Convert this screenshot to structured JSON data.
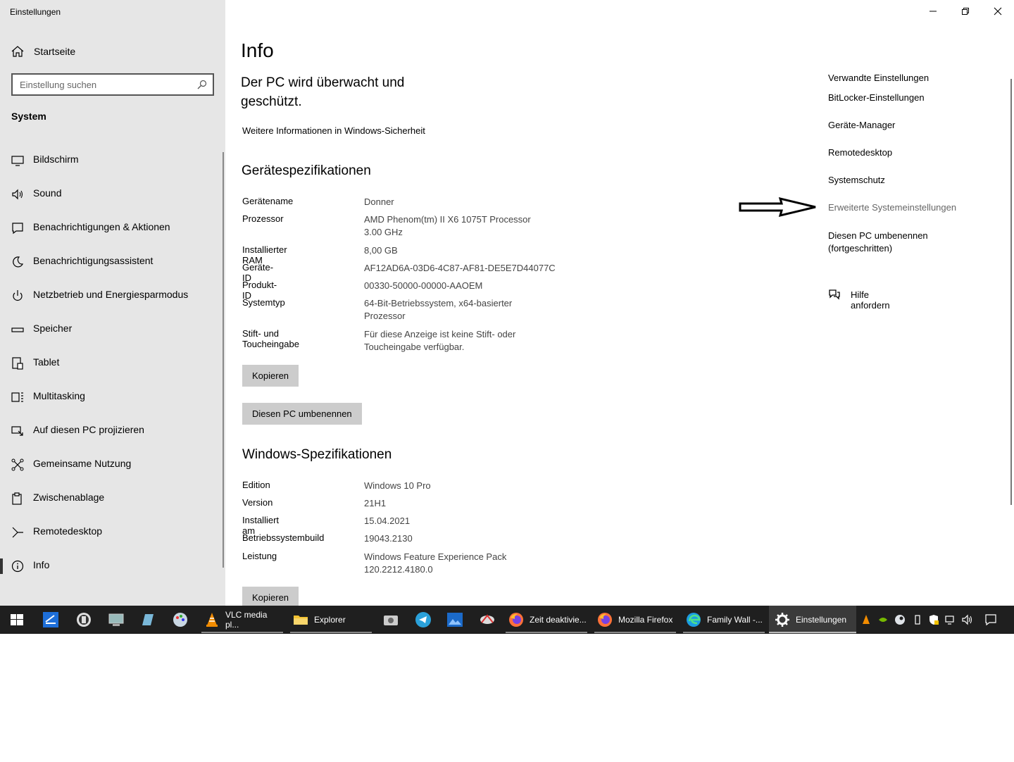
{
  "window": {
    "title": "Einstellungen",
    "controls": {
      "minimize": "minimize-icon",
      "restore": "restore-icon",
      "close": "close-icon"
    }
  },
  "sidebar": {
    "home_label": "Startseite",
    "search_placeholder": "Einstellung suchen",
    "section_label": "System",
    "items": [
      {
        "label": "Bildschirm",
        "icon": "monitor-icon"
      },
      {
        "label": "Sound",
        "icon": "speaker-icon"
      },
      {
        "label": "Benachrichtigungen & Aktionen",
        "icon": "notification-icon"
      },
      {
        "label": "Benachrichtigungsassistent",
        "icon": "moon-icon"
      },
      {
        "label": "Netzbetrieb und Energiesparmodus",
        "icon": "power-icon"
      },
      {
        "label": "Speicher",
        "icon": "storage-icon"
      },
      {
        "label": "Tablet",
        "icon": "tablet-icon"
      },
      {
        "label": "Multitasking",
        "icon": "multitasking-icon"
      },
      {
        "label": "Auf diesen PC projizieren",
        "icon": "project-icon"
      },
      {
        "label": "Gemeinsame Nutzung",
        "icon": "share-icon"
      },
      {
        "label": "Zwischenablage",
        "icon": "clipboard-icon"
      },
      {
        "label": "Remotedesktop",
        "icon": "remote-icon"
      },
      {
        "label": "Info",
        "icon": "info-icon",
        "active": true
      }
    ]
  },
  "main": {
    "title": "Info",
    "protection_text": "Der PC wird überwacht und geschützt.",
    "security_link": "Weitere Informationen in Windows-Sicherheit",
    "device_specs": {
      "heading": "Gerätespezifikationen",
      "rows": [
        {
          "key": "Gerätename",
          "value": "Donner"
        },
        {
          "key": "Prozessor",
          "value": "AMD Phenom(tm) II X6 1075T Processor 3.00 GHz"
        },
        {
          "key": "Installierter RAM",
          "value": "8,00 GB"
        },
        {
          "key": "Geräte-ID",
          "value": "AF12AD6A-03D6-4C87-AF81-DE5E7D44077C"
        },
        {
          "key": "Produkt-ID",
          "value": "00330-50000-00000-AAOEM"
        },
        {
          "key": "Systemtyp",
          "value": "64-Bit-Betriebssystem, x64-basierter Prozessor"
        },
        {
          "key": "Stift- und Toucheingabe",
          "value": "Für diese Anzeige ist keine Stift- oder Toucheingabe verfügbar."
        }
      ],
      "copy_button": "Kopieren",
      "rename_button": "Diesen PC umbenennen"
    },
    "windows_specs": {
      "heading": "Windows-Spezifikationen",
      "rows": [
        {
          "key": "Edition",
          "value": "Windows 10 Pro"
        },
        {
          "key": "Version",
          "value": "21H1"
        },
        {
          "key": "Installiert am",
          "value": "15.04.2021"
        },
        {
          "key": "Betriebssystembuild",
          "value": "19043.2130"
        },
        {
          "key": "Leistung",
          "value": "Windows Feature Experience Pack 120.2212.4180.0"
        }
      ],
      "copy_button": "Kopieren"
    },
    "related": {
      "heading": "Verwandte Einstellungen",
      "links": [
        "BitLocker-Einstellungen",
        "Geräte-Manager",
        "Remotedesktop",
        "Systemschutz",
        "Erweiterte Systemeinstellungen",
        "Diesen PC umbenennen (fortgeschritten)"
      ],
      "help": "Hilfe anfordern"
    }
  },
  "taskbar": {
    "apps": [
      {
        "label": "VLC media pl...",
        "icon": "vlc-icon"
      },
      {
        "label": "Explorer",
        "icon": "folder-icon"
      },
      {
        "label": "Zeit deaktivie...",
        "icon": "firefox-icon"
      },
      {
        "label": "Mozilla Firefox",
        "icon": "firefox-icon"
      },
      {
        "label": "Family Wall -...",
        "icon": "edge-icon"
      },
      {
        "label": "Einstellungen",
        "icon": "gear-icon"
      }
    ]
  }
}
